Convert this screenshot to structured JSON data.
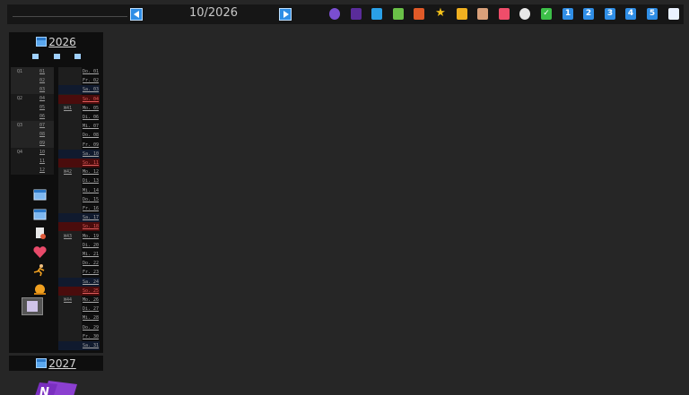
{
  "period": "10/2026",
  "toolbar_icons": [
    {
      "name": "person-icon",
      "color": "#7a4ed0",
      "glyph": ""
    },
    {
      "name": "notebook-purple-icon",
      "color": "#5a2c9a",
      "glyph": ""
    },
    {
      "name": "notebook-blue-icon",
      "color": "#2aa0e8",
      "glyph": ""
    },
    {
      "name": "notebook-green-icon",
      "color": "#6ac048",
      "glyph": ""
    },
    {
      "name": "notebook-red-icon",
      "color": "#e05a28",
      "glyph": ""
    },
    {
      "name": "star-icon",
      "color": "#f5c21a",
      "glyph": "★"
    },
    {
      "name": "lock-icon",
      "color": "#f0b020",
      "glyph": ""
    },
    {
      "name": "house-icon",
      "color": "#d9a07a",
      "glyph": ""
    },
    {
      "name": "bag-icon",
      "color": "#ef4d6a",
      "glyph": ""
    },
    {
      "name": "clock-icon",
      "color": "#e8e8e8",
      "glyph": ""
    },
    {
      "name": "checkmark-icon",
      "color": "#3cbf48",
      "glyph": "✓"
    },
    {
      "name": "number-one-icon",
      "color": "#2f8ee6",
      "glyph": "1"
    },
    {
      "name": "number-two-icon",
      "color": "#2f8ee6",
      "glyph": "2"
    },
    {
      "name": "number-three-icon",
      "color": "#2f8ee6",
      "glyph": "3"
    },
    {
      "name": "number-four-icon",
      "color": "#2f8ee6",
      "glyph": "4"
    },
    {
      "name": "number-five-icon",
      "color": "#2f8ee6",
      "glyph": "5"
    },
    {
      "name": "book-open-icon",
      "color": "#eaf2ff",
      "glyph": ""
    }
  ],
  "year_current": "2026",
  "year_next": "2027",
  "quarters": [
    "Q1",
    "Q2",
    "Q3",
    "Q4"
  ],
  "months": [
    "01",
    "02",
    "03",
    "04",
    "05",
    "06",
    "07",
    "08",
    "09",
    "10",
    "11",
    "12"
  ],
  "weeks": [
    "W41",
    "W42",
    "W43",
    "W44"
  ],
  "days": [
    "Do. 01",
    "Fr. 02",
    "Sa. 03",
    "So. 04",
    "Mo. 05",
    "Di. 06",
    "Mi. 07",
    "Do. 08",
    "Fr. 09",
    "Sa. 10",
    "So. 11",
    "Mo. 12",
    "Di. 13",
    "Mi. 14",
    "Do. 15",
    "Fr. 16",
    "Sa. 17",
    "So. 18",
    "Mo. 19",
    "Di. 20",
    "Mi. 21",
    "Do. 22",
    "Fr. 23",
    "Sa. 24",
    "So. 25",
    "Mo. 26",
    "Di. 27",
    "Mi. 28",
    "Do. 29",
    "Fr. 30",
    "Sa. 31"
  ],
  "side_icons": [
    "calendar-icon",
    "calendar-grid-icon",
    "document-icon",
    "heart-icon",
    "runner-icon",
    "sun-icon",
    "window-icon"
  ]
}
